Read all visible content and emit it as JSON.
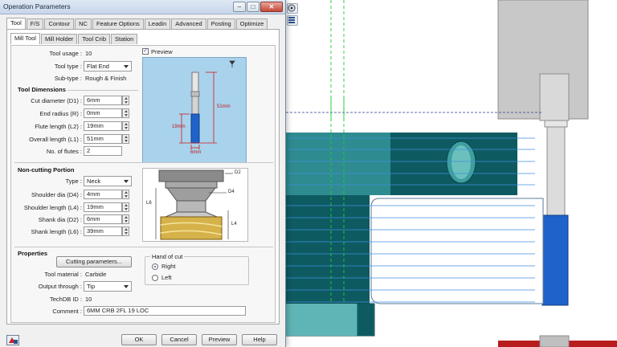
{
  "window": {
    "title": "Operation Parameters",
    "min_glyph": "–",
    "max_glyph": "□",
    "close_glyph": "✕"
  },
  "main_tabs": [
    {
      "label": "Tool",
      "active": true
    },
    {
      "label": "F/S"
    },
    {
      "label": "Contour"
    },
    {
      "label": "NC"
    },
    {
      "label": "Feature Options"
    },
    {
      "label": "Leadin"
    },
    {
      "label": "Advanced"
    },
    {
      "label": "Posting"
    },
    {
      "label": "Optimize"
    }
  ],
  "sub_tabs": [
    {
      "label": "Mill Tool",
      "active": true
    },
    {
      "label": "Mill Holder"
    },
    {
      "label": "Tool Crib"
    },
    {
      "label": "Station"
    }
  ],
  "tool": {
    "usage_label": "Tool usage :",
    "usage_value": "10",
    "type_label": "Tool type :",
    "type_value": "Flat End",
    "subtype_label": "Sub-type :",
    "subtype_value": "Rough & Finish"
  },
  "preview": {
    "label": "Preview",
    "checked": true,
    "checkmark": "✓"
  },
  "tool_dimensions": {
    "heading": "Tool Dimensions",
    "fields": [
      {
        "label": "Cut diameter (D1) :",
        "value": "6mm"
      },
      {
        "label": "End radius (R) :",
        "value": "0mm"
      },
      {
        "label": "Flute length (L2) :",
        "value": "19mm"
      },
      {
        "label": "Overall length (L1) :",
        "value": "51mm"
      }
    ],
    "flutes_label": "No. of flutes :",
    "flutes_value": "2"
  },
  "tool_diagram": {
    "overall": "51mm",
    "flute": "19mm",
    "diameter": "6mm"
  },
  "non_cutting": {
    "heading": "Non-cutting Portion",
    "type_label": "Type :",
    "type_value": "Neck",
    "fields": [
      {
        "label": "Shoulder dia (D4) :",
        "value": "4mm"
      },
      {
        "label": "Shoulder length (L4) :",
        "value": "19mm"
      },
      {
        "label": "Shank dia (D2) :",
        "value": "6mm"
      },
      {
        "label": "Shank length (L6) :",
        "value": "39mm"
      }
    ]
  },
  "neck_diagram": {
    "d2": "D2",
    "d4": "D4",
    "l6": "L6",
    "l4": "L4"
  },
  "properties": {
    "heading": "Properties",
    "cutting_button": "Cutting parameters...",
    "material_label": "Tool material :",
    "material_value": "Carbide",
    "output_label": "Output through :",
    "output_value": "Tip",
    "techdb_label": "TechDB ID :",
    "techdb_value": "10",
    "comment_label": "Comment :",
    "comment_value": "6MM CRB 2FL 19 LOC"
  },
  "hand_of_cut": {
    "title": "Hand of cut",
    "options": [
      {
        "label": "Right",
        "selected": true
      },
      {
        "label": "Left",
        "selected": false
      }
    ]
  },
  "footer": {
    "ok": "OK",
    "cancel": "Cancel",
    "preview": "Preview",
    "help": "Help"
  },
  "colors": {
    "tool_blue": "#1f62c9",
    "part_teal": "#0d5b61",
    "part_light_teal": "#2e8c91",
    "toolpath_blue": "#3f8fe0",
    "guide_green": "#22cc33",
    "holder_gray": "#c8c8c8",
    "gold": "#d6b24a"
  }
}
